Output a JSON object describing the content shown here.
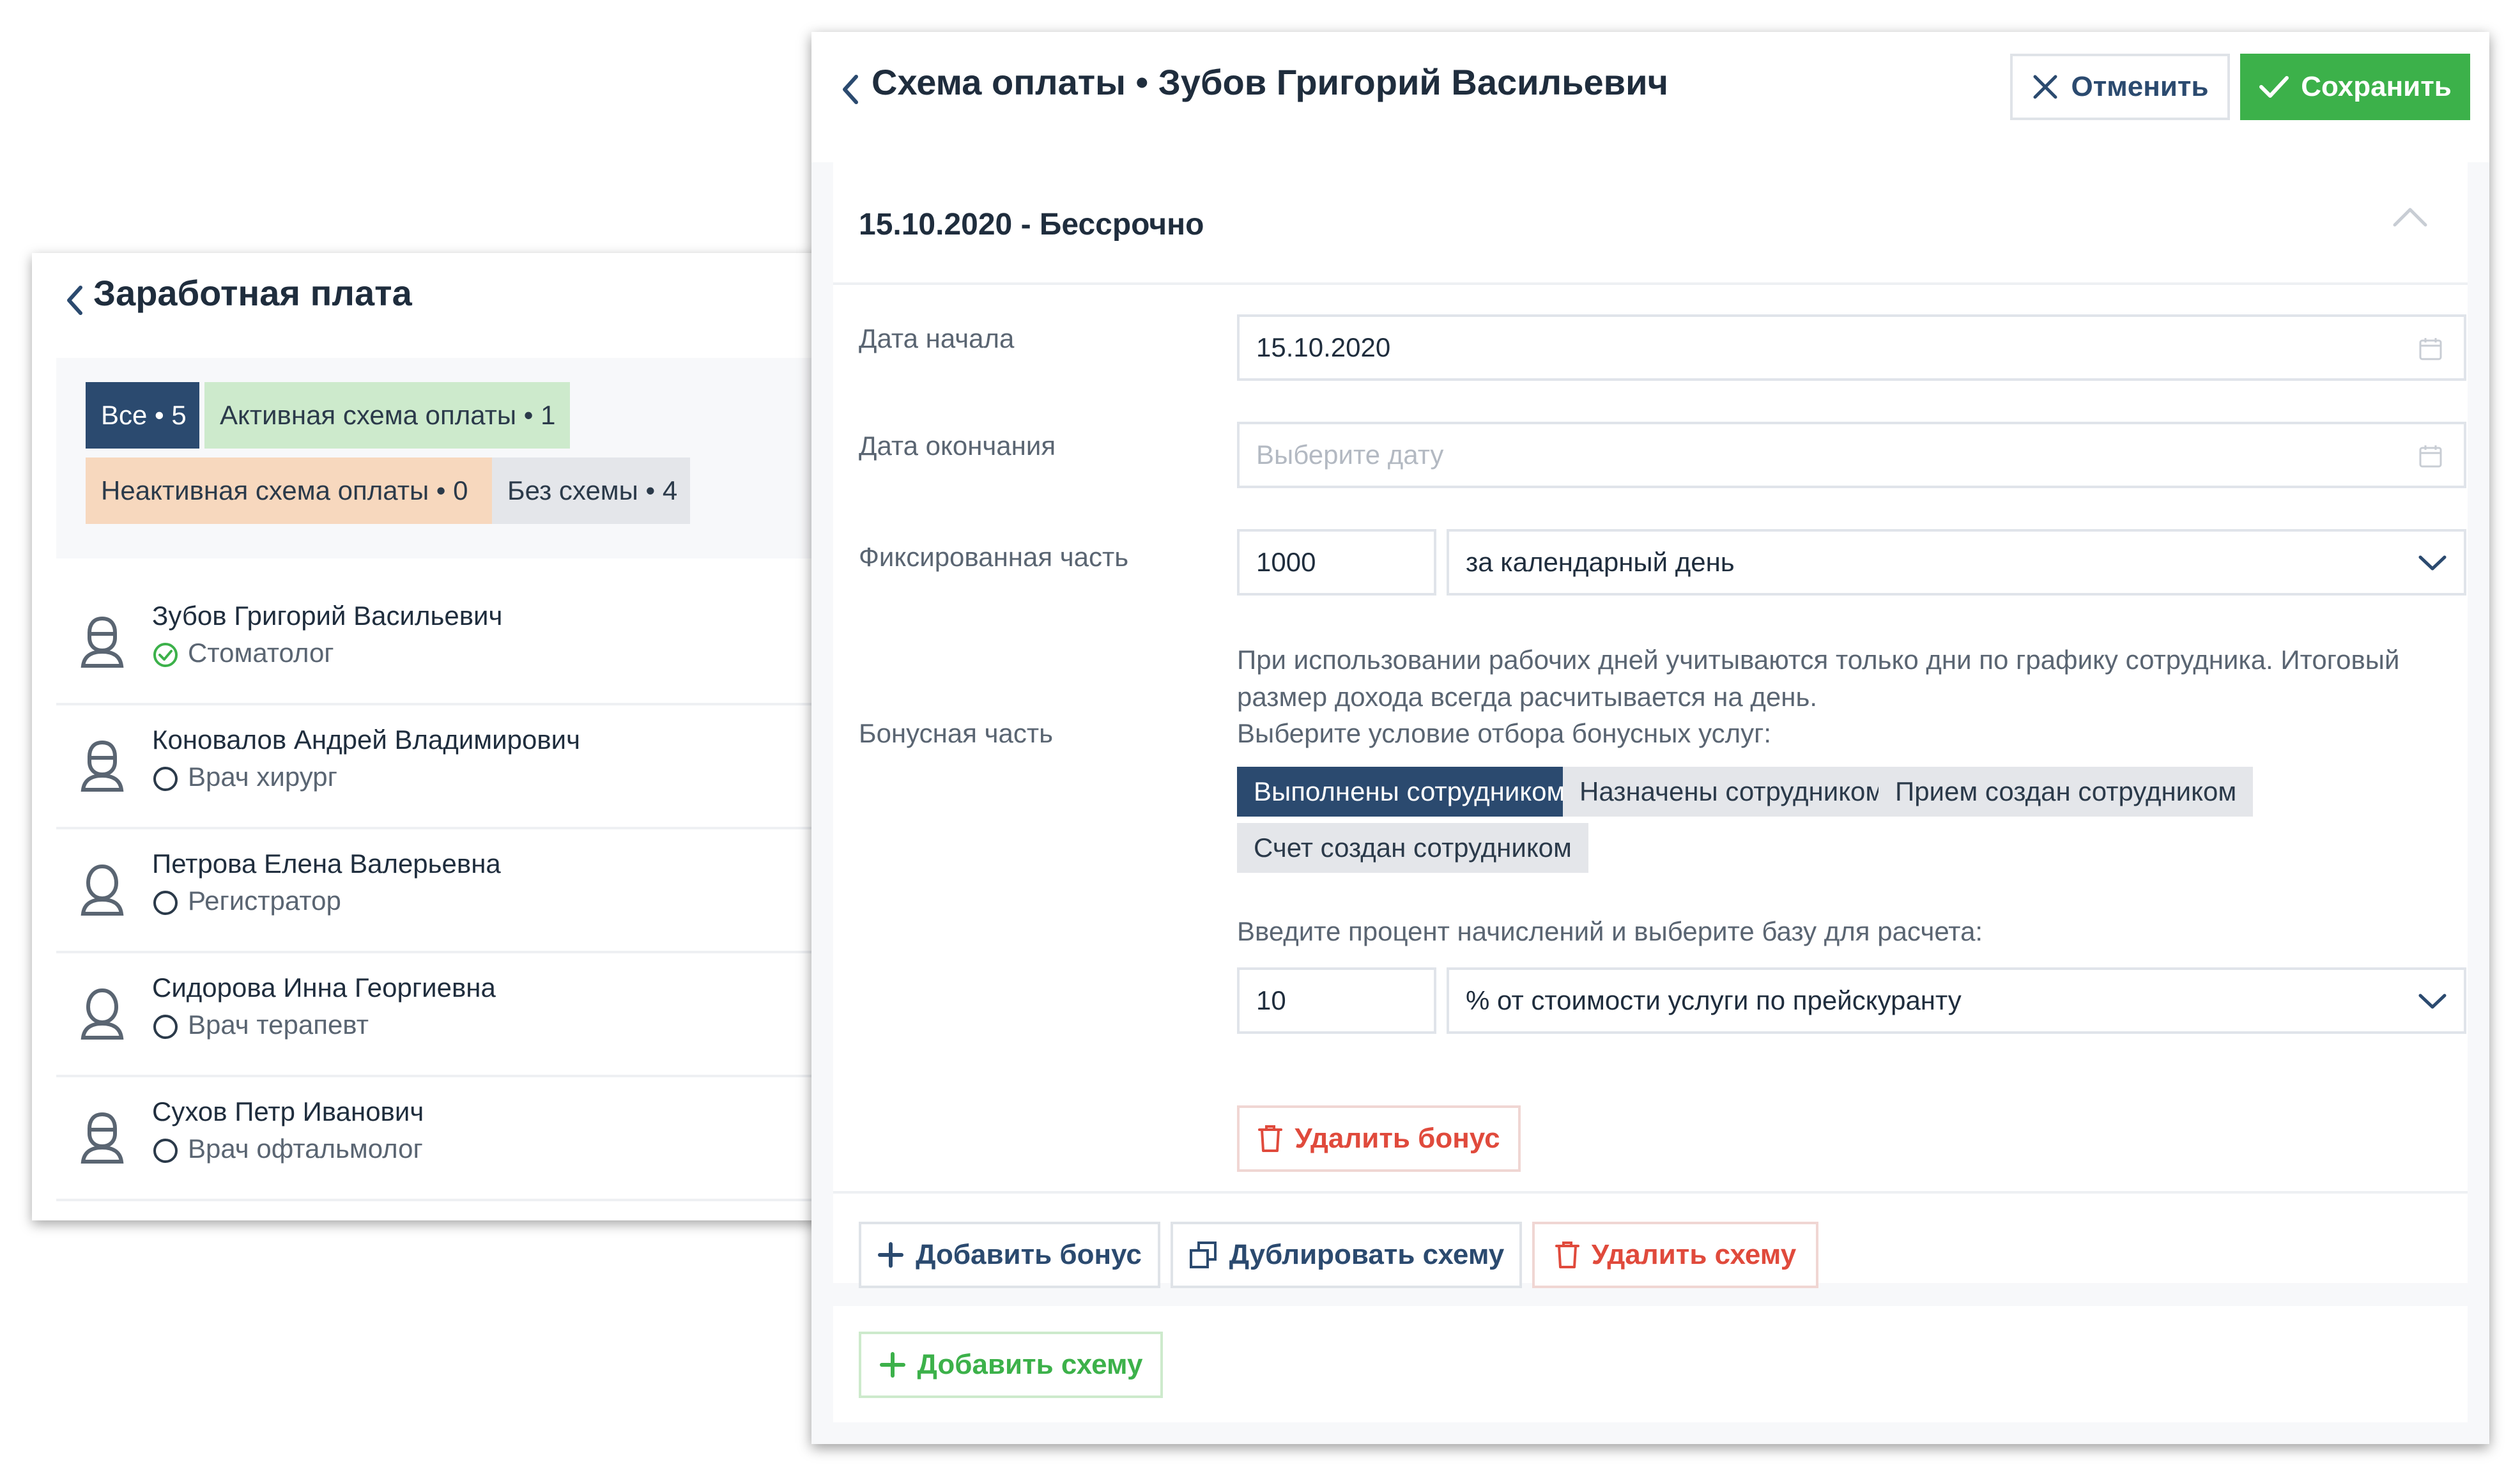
{
  "salary": {
    "title": "Заработная плата",
    "filters": {
      "all": "Все • 5",
      "active": "Активная схема оплаты • 1",
      "inactive": "Неактивная схема оплаты • 0",
      "none": "Без схемы • 4"
    },
    "employees": [
      {
        "name": "Зубов Григорий Васильевич",
        "role": "Стоматолог",
        "active": true
      },
      {
        "name": "Коновалов Андрей Владимирович",
        "role": "Врач хирург",
        "active": false
      },
      {
        "name": "Петрова Елена Валерьевна",
        "role": "Регистратор",
        "active": false
      },
      {
        "name": "Сидорова Инна Георгиевна",
        "role": "Врач терапевт",
        "active": false
      },
      {
        "name": "Сухов Петр Иванович",
        "role": "Врач офтальмолог",
        "active": false
      }
    ]
  },
  "scheme": {
    "title": "Схема оплаты • Зубов Григорий Васильевич",
    "cancel_label": "Отменить",
    "save_label": "Сохранить",
    "period": "15.10.2020 - Бессрочно",
    "start_label": "Дата начала",
    "start_value": "15.10.2020",
    "end_label": "Дата окончания",
    "end_placeholder": "Выберите дату",
    "fixed_label": "Фиксированная часть",
    "fixed_value": "1000",
    "fixed_unit": "за календарный день",
    "fixed_hint": "При использовании рабочих дней учитываются только дни по графику сотрудника. Итоговый размер дохода всегда расчитывается на день.",
    "bonus_label": "Бонусная часть",
    "bonus_condition_label": "Выберите условие отбора бонусных услуг:",
    "bonus_options": [
      "Выполнены сотрудником",
      "Назначены сотрудником",
      "Прием создан сотрудником",
      "Счет создан сотрудником"
    ],
    "bonus_selected_index": 0,
    "percent_label": "Введите процент начислений и выберите базу для расчета:",
    "percent_value": "10",
    "percent_base": "% от стоимости услуги по прейскуранту",
    "delete_bonus_label": "Удалить бонус",
    "add_bonus_label": "Добавить бонус",
    "duplicate_label": "Дублировать схему",
    "delete_scheme_label": "Удалить схему",
    "add_scheme_label": "Добавить схему"
  },
  "colors": {
    "primary": "#2b4a6f",
    "success": "#3cb14a",
    "danger": "#e04a3c",
    "active_chip": "#cdeacc",
    "inactive_chip": "#f7d8be",
    "neutral_chip": "#e4e6ea"
  },
  "icons": {
    "back": "chevron-left-icon",
    "cancel": "close-icon",
    "save": "check-icon",
    "calendar": "calendar-icon",
    "dropdown": "chevron-down-icon",
    "collapse": "chevron-up-icon",
    "avatar": "user-icon",
    "active_role": "check-circle-icon",
    "inactive_role": "circle-icon",
    "delete": "trash-icon",
    "add": "plus-icon",
    "duplicate": "copy-icon"
  }
}
